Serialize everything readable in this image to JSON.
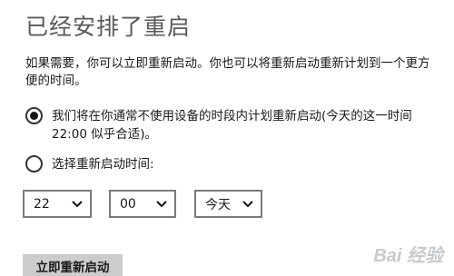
{
  "title": "已经安排了重启",
  "description": "如果需要，你可以立即重新启动。你也可以将重新启动重新计划到一个更方便的时间。",
  "options": [
    {
      "label": "我们将在你通常不使用设备的时段内计划重新启动(今天的这一时间 22:00 似乎合适)。",
      "checked": true
    },
    {
      "label": "选择重新启动时间:",
      "checked": false
    }
  ],
  "selects": {
    "hour": "22",
    "minute": "00",
    "day": "今天"
  },
  "button_label": "立即重新启动",
  "watermark": "Bai 经验",
  "colors": {
    "button_bg": "#cccccc",
    "title": "#595959"
  }
}
